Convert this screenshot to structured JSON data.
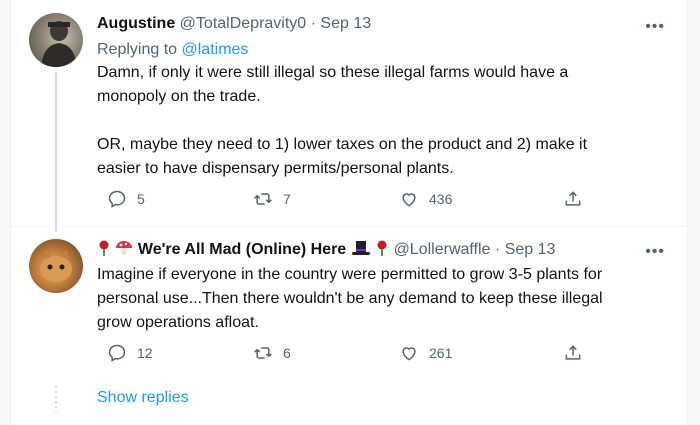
{
  "tweets": [
    {
      "name": "Augustine",
      "handle": "@TotalDepravity0",
      "separator": "·",
      "date": "Sep 13",
      "replying_prefix": "Replying to ",
      "replying_to": "@latimes",
      "text": "Damn, if only it were still illegal so these illegal farms would have a\nmonopoly on the trade.\n\nOR, maybe they need to 1) lower taxes on the product and 2) make it\neasier to have dispensary permits/personal plants.",
      "replies": "5",
      "retweets": "7",
      "likes": "436",
      "more": "•••"
    },
    {
      "name": "We're All Mad (Online) Here",
      "handle": "@Lollerwaffle",
      "separator": "·",
      "date": "Sep 13",
      "text": "Imagine if everyone in the country were permitted to grow 3-5 plants for\npersonal use...Then there wouldn't be any demand to keep these illegal\ngrow operations afloat.",
      "replies": "12",
      "retweets": "6",
      "likes": "261",
      "more": "•••"
    }
  ],
  "show_replies": "Show replies",
  "icons": {
    "reply": "reply-icon",
    "retweet": "retweet-icon",
    "like": "heart-icon",
    "share": "share-icon",
    "more": "more-icon"
  },
  "colors": {
    "link": "#1d9bf0",
    "muted": "#536471",
    "text": "#0f1419"
  }
}
